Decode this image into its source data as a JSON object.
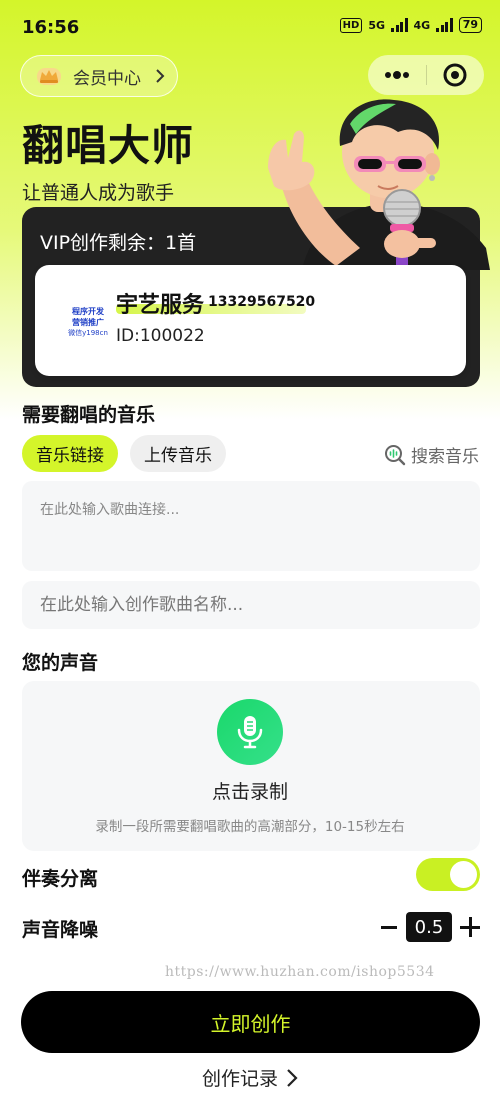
{
  "status_bar": {
    "time": "16:56",
    "hd": "HD",
    "net1": "5G",
    "net2": "4G",
    "battery": "79"
  },
  "header": {
    "member_label": "会员中心"
  },
  "hero": {
    "title": "翻唱大师",
    "subtitle": "让普通人成为歌手"
  },
  "vip": {
    "text": "VIP创作剩余：1首"
  },
  "user": {
    "logo_lines": [
      "程序开发",
      "营销推广",
      "微信y198cn"
    ],
    "name": "宇艺服务",
    "phone": "13329567520",
    "id": "ID:100022"
  },
  "music": {
    "section_title": "需要翻唱的音乐",
    "tabs": [
      {
        "label": "音乐链接",
        "active": true
      },
      {
        "label": "上传音乐",
        "active": false
      }
    ],
    "search_label": "搜索音乐",
    "link_placeholder": "在此处输入歌曲连接...",
    "name_placeholder": "在此处输入创作歌曲名称..."
  },
  "voice": {
    "section_title": "您的声音",
    "record_label": "点击录制",
    "record_hint": "录制一段所需要翻唱歌曲的高潮部分，10-15秒左右"
  },
  "settings": {
    "accompaniment_label": "伴奏分离",
    "accompaniment_on": true,
    "noise_label": "声音降噪",
    "noise_value": "0.5"
  },
  "watermark": "https://www.huzhan.com/ishop5534",
  "actions": {
    "create_label": "立即创作",
    "records_label": "创作记录"
  },
  "colors": {
    "accent": "#d4f52a",
    "mic_green": "#1ad86b",
    "dark": "#222222"
  }
}
